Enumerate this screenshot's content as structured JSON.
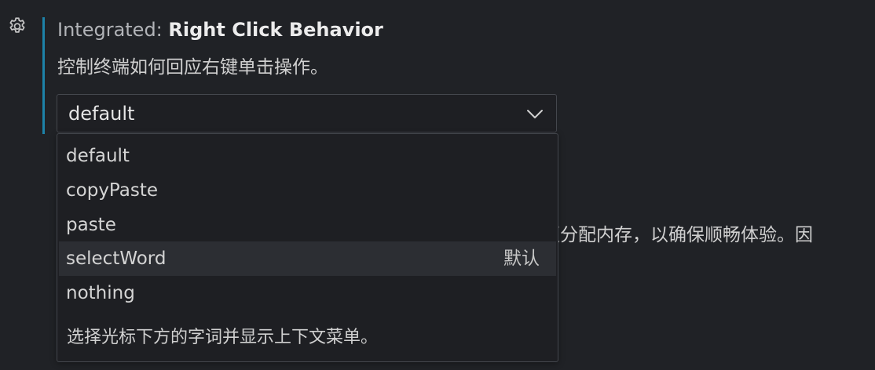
{
  "setting": {
    "category": "Integrated: ",
    "name": "Right Click Behavior",
    "description": "控制终端如何回应右键单击操作。"
  },
  "select": {
    "value": "default",
    "options": [
      {
        "label": "default"
      },
      {
        "label": "copyPaste"
      },
      {
        "label": "paste"
      },
      {
        "label": "selectWord",
        "badge": "默认"
      },
      {
        "label": "nothing"
      }
    ],
    "highlighted_option_description": "选择光标下方的字词并显示上下文菜单。"
  },
  "background_text": "须分配内存，以确保顺畅体验。因",
  "colors": {
    "background": "#202226",
    "focus_bar": "#1d82a8",
    "dropdown_background": "#1e1f23",
    "dropdown_border": "#44474d",
    "highlight_row": "#2c2e33"
  },
  "icons": {
    "settings": "gear-icon",
    "select_toggle": "chevron-down-icon"
  }
}
